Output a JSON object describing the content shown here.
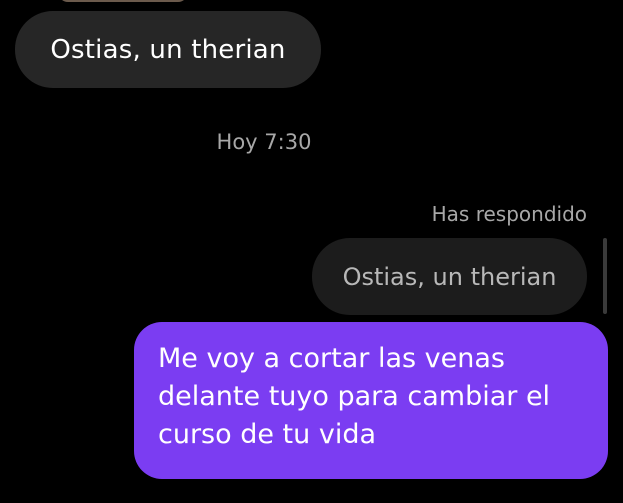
{
  "messages": {
    "incoming_text": "Ostias, un therian",
    "timestamp": "Hoy 7:30",
    "reply_label": "Has respondido",
    "quoted_text": "Ostias, un therian",
    "outgoing_text": "Me voy a cortar las venas delante tuyo para cambiar el curso de tu vida"
  },
  "colors": {
    "background": "#000000",
    "incoming_bubble": "#262626",
    "quoted_bubble": "#1c1c1c",
    "outgoing_bubble": "#7b3df2",
    "meta_text": "#a8a8a8"
  }
}
